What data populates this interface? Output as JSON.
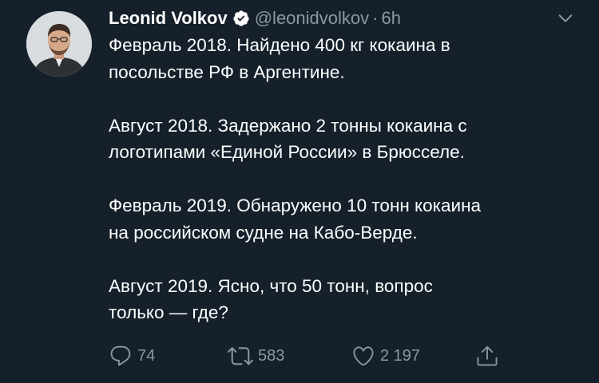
{
  "tweet": {
    "display_name": "Leonid Volkov",
    "handle": "@leonidvolkov",
    "separator": "·",
    "time": "6h",
    "paragraphs": [
      "Февраль 2018. Найдено 400 кг кокаина в\nпосольстве РФ в Аргентине.",
      "Август 2018. Задержано 2 тонны кокаина с\nлоготипами «Единой России» в Брюсселе.",
      "Февраль 2019. Обнаружено 10 тонн кокаина\nна российском судне  на Кабо-Верде.",
      "Август 2019. Ясно, что 50 тонн, вопрос\nтолько — где?"
    ]
  },
  "actions": {
    "reply_count": "74",
    "retweet_count": "583",
    "like_count": "2 197"
  },
  "icons": {
    "verified": "verified-badge-icon",
    "caret": "chevron-down-icon",
    "reply": "reply-icon",
    "retweet": "retweet-icon",
    "like": "heart-icon",
    "share": "share-icon"
  },
  "colors": {
    "background": "#15202b",
    "text": "#ffffff",
    "secondary": "#8899a6",
    "verified_badge": "#ffffff"
  }
}
